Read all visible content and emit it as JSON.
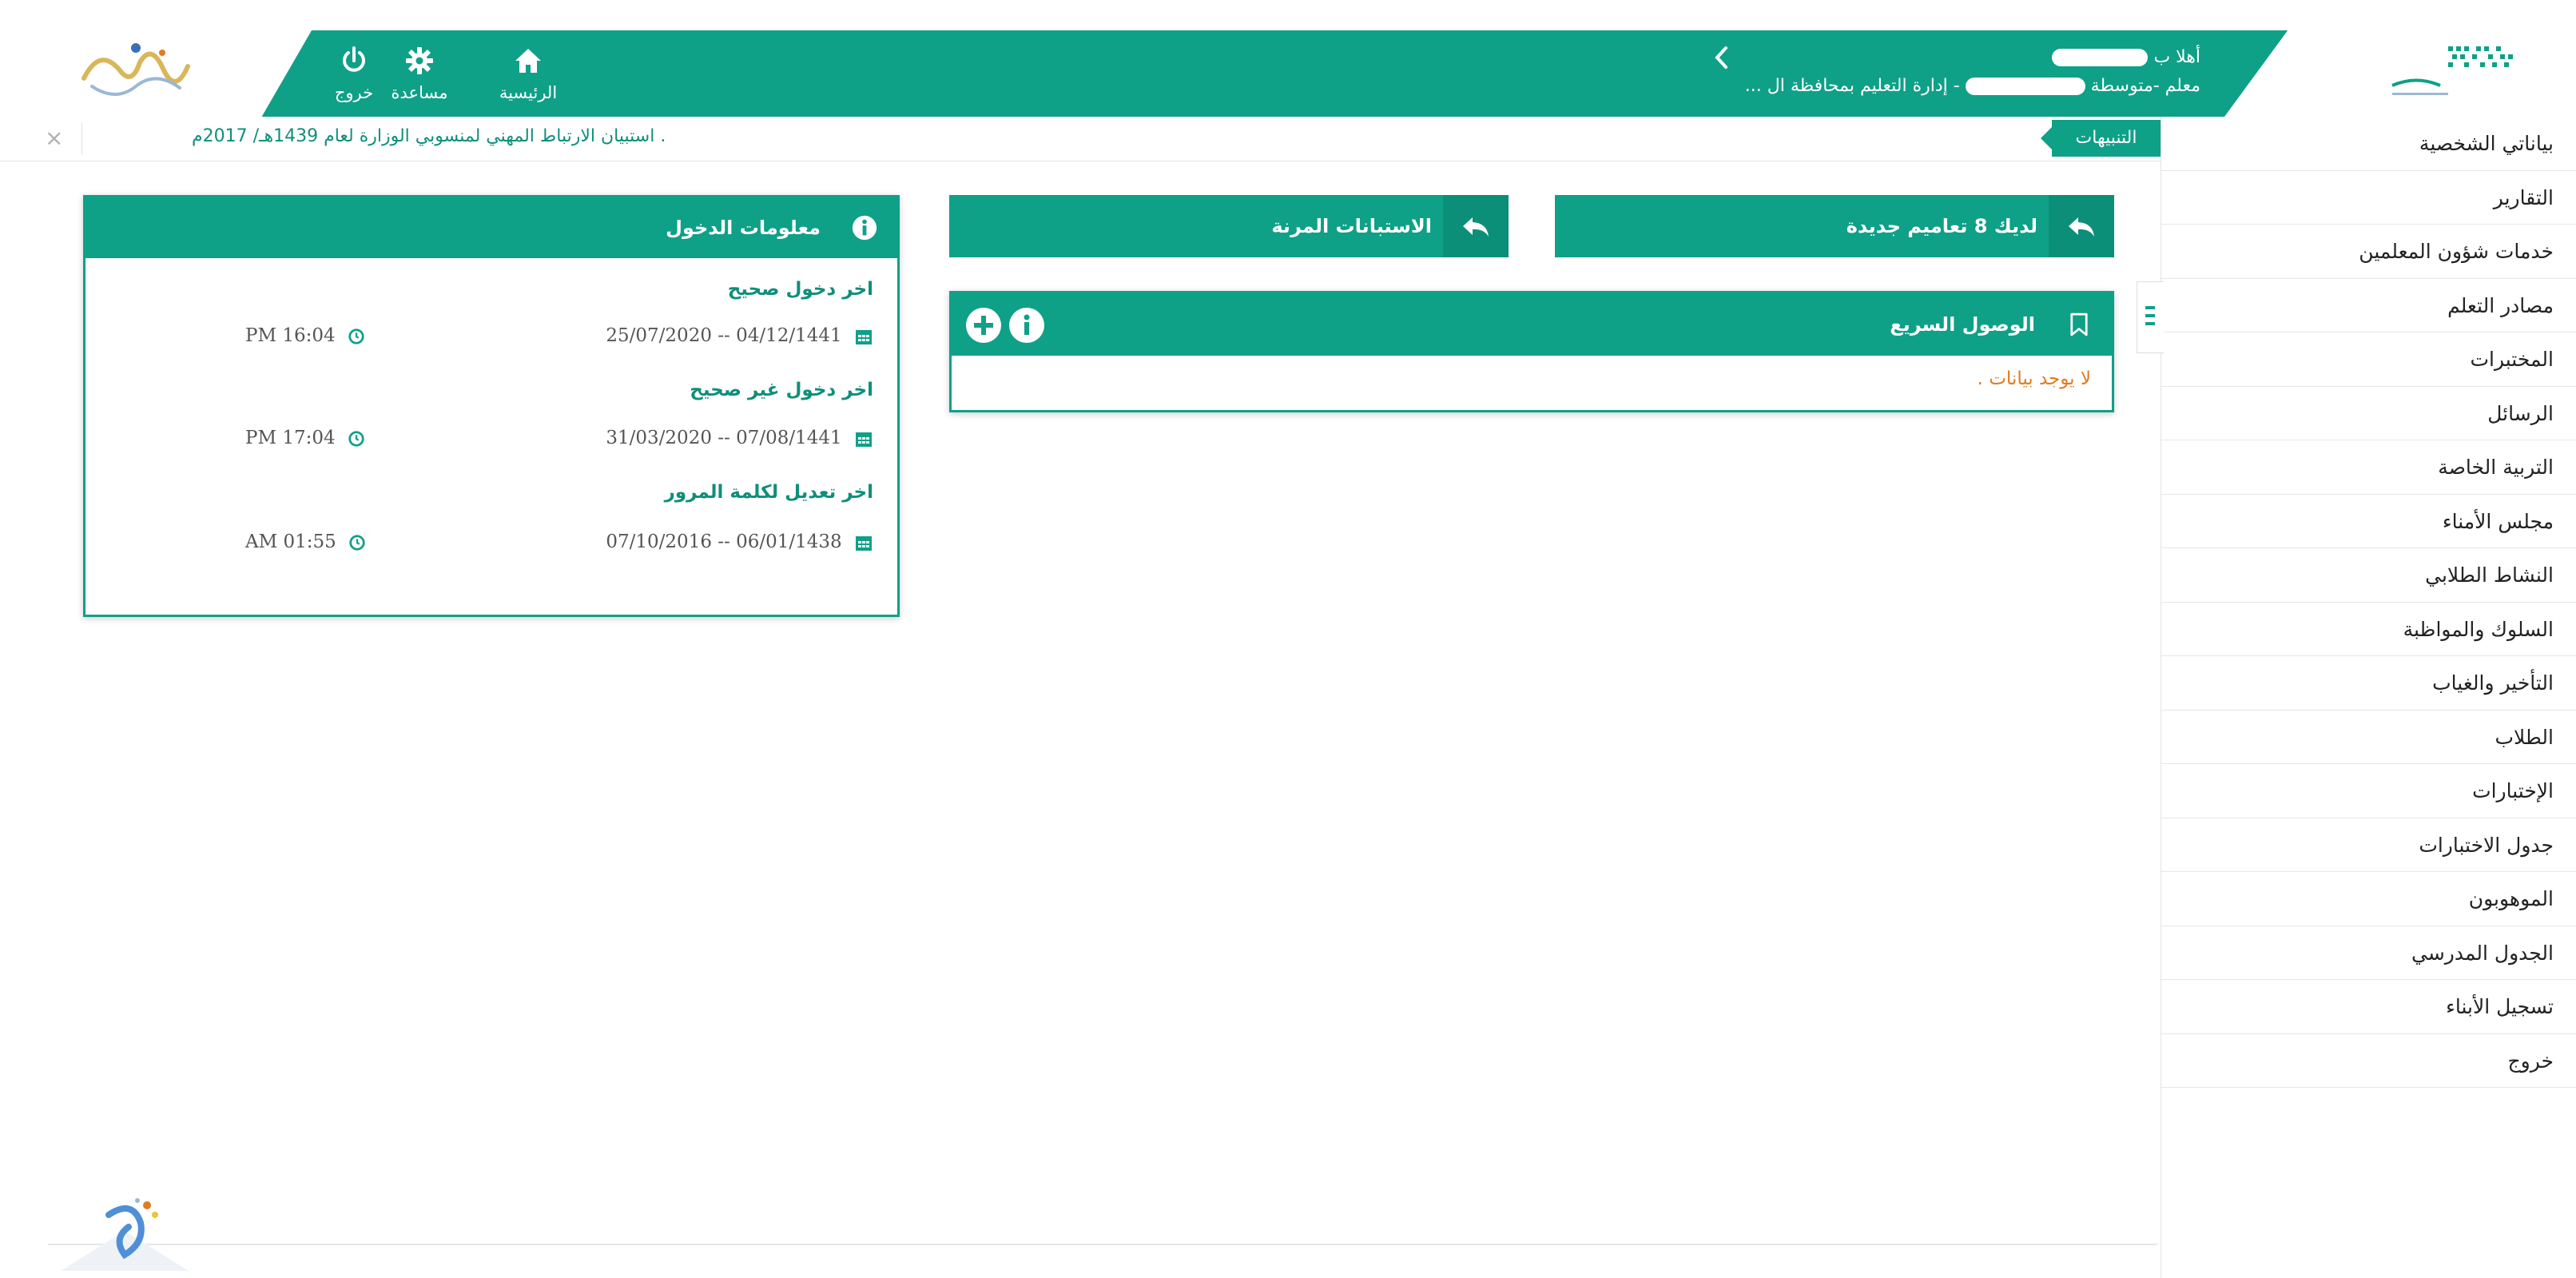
{
  "header": {
    "nav": [
      {
        "id": "logout",
        "label": "خروج",
        "icon": "power-icon"
      },
      {
        "id": "help",
        "label": "مساعدة",
        "icon": "gear-icon"
      },
      {
        "id": "home",
        "label": "الرئيسية",
        "icon": "home-icon"
      }
    ],
    "greeting_prefix": "أهلا ب",
    "line2_prefix": "معلم -متوسطة",
    "line2_suffix": "- إدارة التعليم بمحافظة ال ...",
    "colors": {
      "primary": "#0fa088",
      "dark": "#0b8f79",
      "warning": "#e07b21"
    }
  },
  "announcement": {
    "tab_label": "التنبيهات",
    "text": ". استبيان الارتباط المهني لمنسوبي الوزارة لعام 1439هـ/ 2017م",
    "close_symbol": "×"
  },
  "cards": {
    "circulars": "لديك 8 تعاميم جديدة",
    "surveys": "الاستبانات المرنة"
  },
  "quick_access": {
    "title": "الوصول السريع",
    "empty": "لا يوجد بيانات ."
  },
  "login_info": {
    "title": "معلومات الدخول",
    "rows": [
      {
        "label": "اخر دخول صحيح",
        "date": "25/07/2020 -- 04/12/1441",
        "time": "PM 16:04"
      },
      {
        "label": "اخر دخول غير صحيح",
        "date": "31/03/2020 -- 07/08/1441",
        "time": "PM 17:04"
      },
      {
        "label": "اخر تعديل لكلمة المرور",
        "date": "07/10/2016 -- 06/01/1438",
        "time": "AM 01:55"
      }
    ]
  },
  "sidebar": {
    "items": [
      "بياناتي الشخصية",
      "التقارير",
      "خدمات شؤون المعلمين",
      "مصادر التعلم",
      "المختبرات",
      "الرسائل",
      "التربية الخاصة",
      "مجلس الأمناء",
      "النشاط الطلابي",
      "السلوك والمواظبة",
      "التأخير والغياب",
      "الطلاب",
      "الإختبارات",
      "جدول الاختبارات",
      "الموهوبون",
      "الجدول المدرسي",
      "تسجيل الأبناء",
      "خروج"
    ]
  }
}
